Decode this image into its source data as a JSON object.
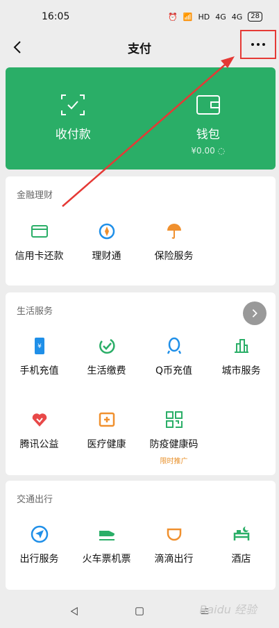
{
  "status": {
    "time": "16:05",
    "battery": "28",
    "net1": "4G",
    "net2": "4G",
    "hd": "HD"
  },
  "nav": {
    "title": "支付"
  },
  "card": {
    "pay_label": "收付款",
    "wallet_label": "钱包",
    "wallet_balance": "¥0.00"
  },
  "finance": {
    "title": "金融理财",
    "items": [
      {
        "label": "信用卡还款",
        "icon": "credit-card-icon"
      },
      {
        "label": "理财通",
        "icon": "licaitong-icon"
      },
      {
        "label": "保险服务",
        "icon": "insurance-icon"
      }
    ]
  },
  "life": {
    "title": "生活服务",
    "items": [
      {
        "label": "手机充值",
        "icon": "phone-recharge-icon"
      },
      {
        "label": "生活缴费",
        "icon": "bill-pay-icon"
      },
      {
        "label": "Q币充值",
        "icon": "qq-coin-icon"
      },
      {
        "label": "城市服务",
        "icon": "city-service-icon"
      },
      {
        "label": "腾讯公益",
        "icon": "charity-icon"
      },
      {
        "label": "医疗健康",
        "icon": "medical-icon"
      },
      {
        "label": "防疫健康码",
        "icon": "health-code-icon",
        "tag": "限时推广"
      }
    ]
  },
  "travel": {
    "title": "交通出行",
    "items": [
      {
        "label": "出行服务",
        "icon": "travel-service-icon"
      },
      {
        "label": "火车票机票",
        "icon": "train-ticket-icon"
      },
      {
        "label": "滴滴出行",
        "icon": "didi-icon"
      },
      {
        "label": "酒店",
        "icon": "hotel-icon"
      }
    ]
  },
  "watermark": "Baidu 经验",
  "colors": {
    "green": "#2aae67",
    "blue": "#1f8fe8",
    "orange": "#f0902e",
    "red": "#e53935"
  }
}
